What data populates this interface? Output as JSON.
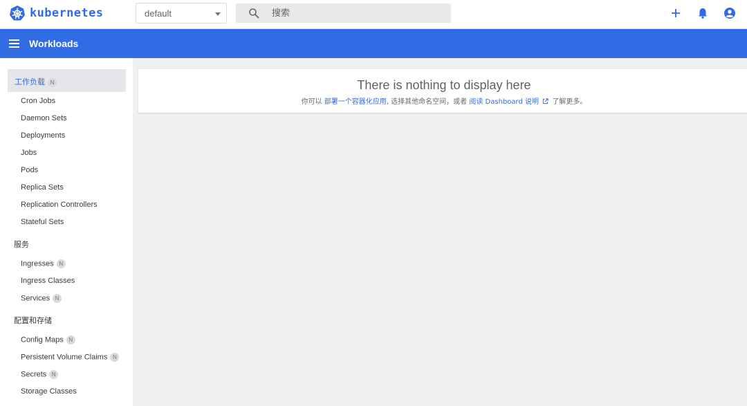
{
  "topbar": {
    "brand": "kubernetes",
    "namespace": "default",
    "search_placeholder": "搜索",
    "icons": [
      "add-icon",
      "bell-icon",
      "account-icon"
    ]
  },
  "appbar": {
    "title": "Workloads"
  },
  "sidebar": {
    "workloads": {
      "label": "工作负载",
      "badge": "N"
    },
    "workload_items": [
      "Cron Jobs",
      "Daemon Sets",
      "Deployments",
      "Jobs",
      "Pods",
      "Replica Sets",
      "Replication Controllers",
      "Stateful Sets"
    ],
    "services_section": "服务",
    "service_items": [
      {
        "label": "Ingresses",
        "badge": "N"
      },
      {
        "label": "Ingress Classes"
      },
      {
        "label": "Services",
        "badge": "N"
      }
    ],
    "config_section": "配置和存储",
    "config_items": [
      {
        "label": "Config Maps",
        "badge": "N"
      },
      {
        "label": "Persistent Volume Claims",
        "badge": "N"
      },
      {
        "label": "Secrets",
        "badge": "N"
      },
      {
        "label": "Storage Classes"
      }
    ]
  },
  "main": {
    "empty_title": "There is nothing to display here",
    "hint_prefix": "你可以",
    "hint_link1": "部署一个容器化应用",
    "hint_mid": ", 选择其他命名空间，或者",
    "hint_link2": "阅读 Dashboard 说明",
    "hint_suffix": "了解更多。"
  },
  "colors": {
    "accent": "#326ce5",
    "background": "#eef0f2",
    "surface": "#ffffff"
  }
}
